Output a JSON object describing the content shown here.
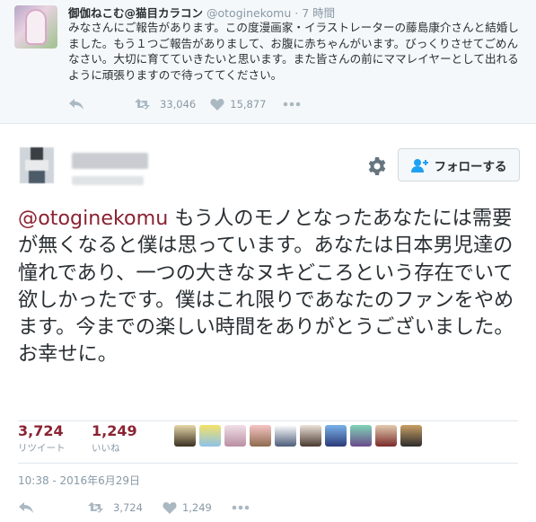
{
  "quoted_tweet": {
    "display_name": "御伽ねこむ@猫目カラコン",
    "handle": "@otoginekomu",
    "time": "· 7 時間",
    "text": "みなさんにご報告があります。この度漫画家・イラストレーターの藤島康介さんと結婚しました。もう１つご報告がありまして、お腹に赤ちゃんがいます。びっくりさせてごめんなさい。大切に育てていきたいと思います。また皆さんの前にママレイヤーとして出れるように頑張りますので待っててください。",
    "retweet_count": "33,046",
    "like_count": "15,877",
    "icons": [
      "reply-icon",
      "retweet-icon",
      "heart-icon",
      "more-icon"
    ]
  },
  "main_tweet": {
    "follow_label": "フォローする",
    "mention": "@otoginekomu",
    "text": " もう人のモノとなったあなたには需要が無くなると僕は思っています。あなたは日本男児達の憧れであり、一つの大きなヌキどころという存在でいて欲しかったです。僕はこれ限りであなたのファンをやめます。今までの楽しい時間をありがとうございました。お幸せに。",
    "retweets": {
      "count": "3,724",
      "label": "リツイート"
    },
    "likes": {
      "count": "1,249",
      "label": "いいね"
    },
    "timestamp": "10:38 - 2016年6月29日",
    "action_retweet_count": "3,724",
    "action_like_count": "1,249"
  },
  "colors": {
    "accent": "#8b2332",
    "muted": "#8899a6",
    "text": "#292f33",
    "quoted_bg": "#f5f8fa"
  }
}
